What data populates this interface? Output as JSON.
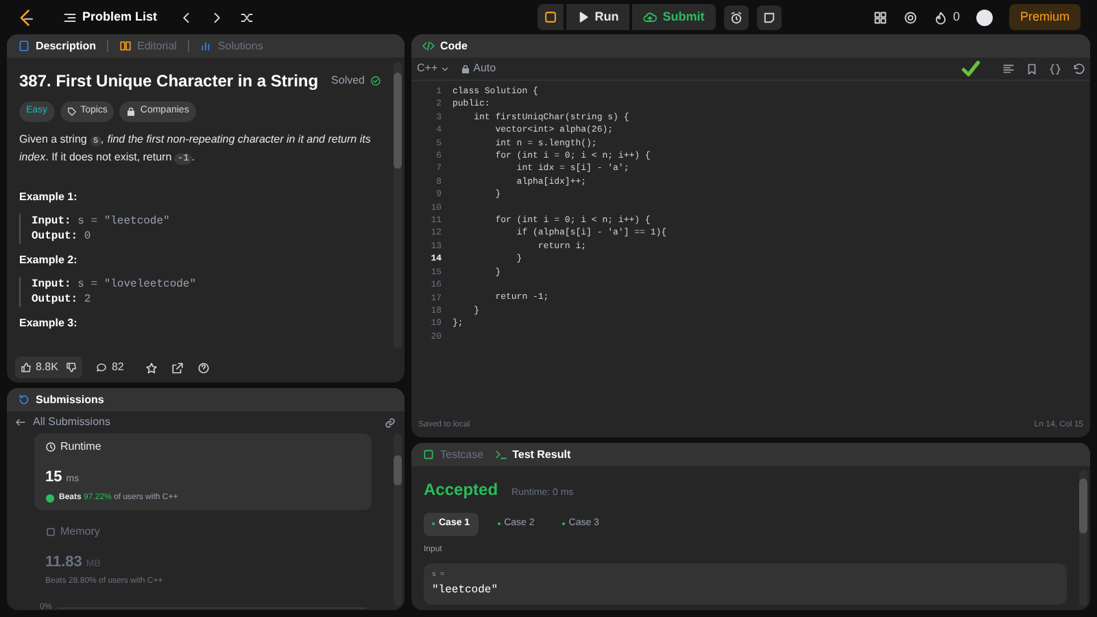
{
  "topbar": {
    "problem_list": "Problem List",
    "run": "Run",
    "submit": "Submit",
    "streak": "0",
    "premium": "Premium"
  },
  "description_panel": {
    "tabs": [
      {
        "label": "Description",
        "selected": true
      },
      {
        "label": "Editorial",
        "selected": false
      },
      {
        "label": "Solutions",
        "selected": false
      }
    ],
    "title": "387. First Unique Character in a String",
    "status": "Solved",
    "difficulty": "Easy",
    "tags": [
      "Topics",
      "Companies"
    ],
    "statement": [
      {
        "kind": "text",
        "text": "Given a string "
      },
      {
        "kind": "code",
        "text": "s"
      },
      {
        "kind": "italic",
        "text": ", find the first non-repeating character in it and return its index"
      },
      {
        "kind": "text",
        "text": ". If it does not exist, return "
      },
      {
        "kind": "code",
        "text": "-1"
      },
      {
        "kind": "text",
        "text": "."
      }
    ],
    "examples": [
      {
        "title": "Example 1:",
        "input_label": "Input:",
        "input": "s = \"leetcode\"",
        "output_label": "Output:",
        "output": "0"
      },
      {
        "title": "Example 2:",
        "input_label": "Input:",
        "input": "s = \"loveleetcode\"",
        "output_label": "Output:",
        "output": "2"
      },
      {
        "title": "Example 3:"
      }
    ],
    "footer": {
      "likes": "8.8K",
      "comments": "82"
    }
  },
  "submissions_panel": {
    "title": "Submissions",
    "back": "All Submissions",
    "runtime": {
      "label": "Runtime",
      "value": "15",
      "unit": "ms",
      "beats": "Beats ",
      "percent": "97.22%",
      "suffix": " of users with C++"
    },
    "memory": {
      "label": "Memory",
      "value": "11.83",
      "unit": "MB",
      "beats": "Beats 28.80% of users with C++"
    },
    "axis_label": "0%"
  },
  "code_panel": {
    "title": "Code",
    "language": "C++",
    "mode": "Auto",
    "lines": [
      {
        "number": "1",
        "text": "class Solution {",
        "current": false
      },
      {
        "number": "2",
        "text": "public:",
        "current": false
      },
      {
        "number": "3",
        "text": "    int firstUniqChar(string s) {",
        "current": false
      },
      {
        "number": "4",
        "text": "        vector<int> alpha(26);",
        "current": false
      },
      {
        "number": "5",
        "text": "        int n = s.length();",
        "current": false
      },
      {
        "number": "6",
        "text": "        for (int i = 0; i < n; i++) {",
        "current": false
      },
      {
        "number": "7",
        "text": "            int idx = s[i] - 'a';",
        "current": false
      },
      {
        "number": "8",
        "text": "            alpha[idx]++;",
        "current": false
      },
      {
        "number": "9",
        "text": "        }",
        "current": false
      },
      {
        "number": "10",
        "current": false
      },
      {
        "number": "11",
        "text": "        for (int i = 0; i < n; i++) {",
        "current": false
      },
      {
        "number": "12",
        "text": "            if (alpha[s[i] - 'a'] == 1){",
        "current": false
      },
      {
        "number": "13",
        "text": "                return i;",
        "current": false
      },
      {
        "number": "14",
        "text": "            }",
        "current": true
      },
      {
        "number": "15",
        "text": "        }",
        "current": false
      },
      {
        "number": "16",
        "current": false
      },
      {
        "number": "17",
        "text": "        return -1;",
        "current": false
      },
      {
        "number": "18",
        "text": "    }",
        "current": false
      },
      {
        "number": "19",
        "text": "};",
        "current": false
      },
      {
        "number": "20",
        "current": false
      }
    ],
    "saved": "Saved to local",
    "cursor": "Ln 14, Col 15"
  },
  "test_panel": {
    "tabs": [
      {
        "label": "Testcase",
        "selected": false
      },
      {
        "label": "Test Result",
        "selected": true
      }
    ],
    "result": "Accepted",
    "runtime": "Runtime: 0 ms",
    "cases": [
      {
        "label": "Case 1",
        "selected": true
      },
      {
        "label": "Case 2",
        "selected": false
      },
      {
        "label": "Case 3",
        "selected": false
      }
    ],
    "input_label": "Input",
    "var": "s =",
    "value": "\"leetcode\""
  }
}
